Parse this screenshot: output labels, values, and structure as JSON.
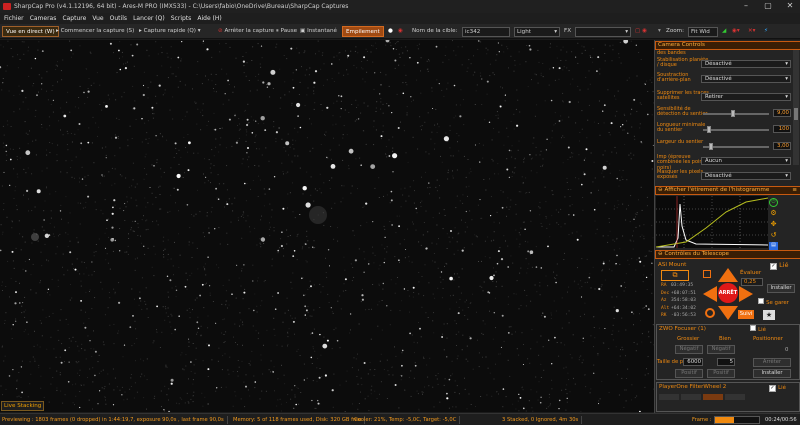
{
  "window": {
    "title": "SharpCap Pro (v4.1.12196, 64 bit) - Ares-M PRO (IMX533) - C:\\Users\\fabio\\OneDrive\\Bureau\\SharpCap Captures",
    "minimize": "–",
    "maximize": "▢",
    "close": "✕"
  },
  "menu": [
    "Fichier",
    "Cameras",
    "Capture",
    "Vue",
    "Outils",
    "Lancer (Q)",
    "Scripts",
    "Aide (H)"
  ],
  "toolbar": {
    "live_view": "Vue en direct (W)",
    "start_capture": "Commencer la capture (S)",
    "quick_capture": "Capture rapide (Q)",
    "stop_capture": "Arrêter la capture",
    "pause": "Pause",
    "snapshot": "Instantané",
    "stacking": "Empilement",
    "target_label": "Nom de la cible:",
    "target_value": "ic342",
    "frame_type": "Light",
    "fx_label": "FX",
    "zoom_label": "Zoom:",
    "zoom_value": "Fit Wid"
  },
  "panel": {
    "camera_controls": "Camera Controls",
    "rows": [
      {
        "label": "des bandes",
        "value": ""
      },
      {
        "label": "Stabilisation planète / disque",
        "value": "Désactivé"
      },
      {
        "label": "Soustraction d'arrière-plan",
        "value": "Désactivé"
      },
      {
        "label": "Supprimer les traces satellites",
        "value": "Retirer"
      },
      {
        "label": "Sensibilité de détection du sentier",
        "value": "9,00"
      },
      {
        "label": "Longueur minimale du sentier",
        "value": "100"
      },
      {
        "label": "Largeur du sentier",
        "value": "3,00"
      },
      {
        "label": "Imp (épreuve combinée les points noirs)",
        "value": "Aucun"
      },
      {
        "label": "Masquer les pixels exposés",
        "value": "Désactivé"
      }
    ],
    "histogram_title": "Afficher l'étirement de l'histogramme",
    "telescope_title": "Contrôles du Télescope",
    "mount_name": "ASI Mount",
    "mount_linked": "Lié",
    "evaluate_label": "Évaluer",
    "evaluate_value": "0,25",
    "install_button": "Installer",
    "coords": [
      {
        "k": "RA",
        "v": "03:49:35"
      },
      {
        "k": "Dec",
        "v": "+68:07:51"
      },
      {
        "k": "Az",
        "v": "354:58:03"
      },
      {
        "k": "Alt",
        "v": "+64:34:02"
      },
      {
        "k": "RK",
        "v": "-03:56:53"
      }
    ],
    "parked_label": "Se garer",
    "follow_label": "Suivi",
    "focuser_title": "ZWO Focuser (1)",
    "focuser_linked": "Lié",
    "focuser_cols": [
      "Grossier",
      "Bien",
      "Positionner"
    ],
    "focuser_pos": "0",
    "step_label": "Taille de pas",
    "step_value": "6000",
    "fine_value": "5",
    "neg": "Négatif",
    "pos": "Positif",
    "stop": "Arrêter",
    "install": "Installer",
    "filterwheel_title": "PlayerOne FilterWheel 2",
    "filterwheel_linked": "Lié"
  },
  "live_stacking_tab": "Live Stacking",
  "status": {
    "preview": "Previewing : 1803 frames (0 dropped) in 1:44:19,7, exposure 90,0s , last frame 90,0s",
    "memory": "Memory: 5 of 118 frames used, Disk: 320 GB free",
    "cooler": "Cooler: 21%, Temp: -5,0C, Target: -5,0C",
    "stacked": "3 Stacked, 0 Ignored, 4m 30s",
    "frame_label": "Frame :",
    "frame_time": "00:24/00:56"
  },
  "colors": {
    "accent": "#f08a10",
    "panel_header": "#c85a10"
  }
}
